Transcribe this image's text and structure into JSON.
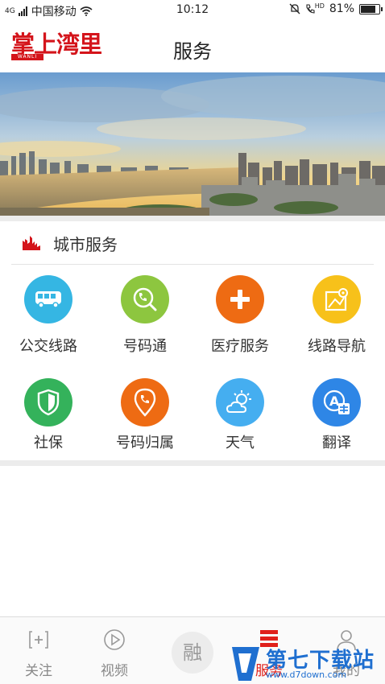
{
  "status_bar": {
    "signal_label": "4G",
    "carrier": "中国移动",
    "time": "10:12",
    "hd_label": "HD",
    "battery_text": "81%",
    "battery_level": 0.81
  },
  "header": {
    "logo_text": "掌上湾里",
    "logo_sub": "WANLI",
    "title": "服务"
  },
  "section": {
    "title": "城市服务"
  },
  "services": [
    {
      "label": "公交线路",
      "icon": "bus-icon",
      "color": "#35b6e3"
    },
    {
      "label": "号码通",
      "icon": "phone-search-icon",
      "color": "#8dc63f"
    },
    {
      "label": "医疗服务",
      "icon": "medical-plus-icon",
      "color": "#ee6b13"
    },
    {
      "label": "线路导航",
      "icon": "map-navigation-icon",
      "color": "#f7c11a"
    },
    {
      "label": "社保",
      "icon": "shield-icon",
      "color": "#34b25b"
    },
    {
      "label": "号码归属",
      "icon": "phone-location-icon",
      "color": "#ee6b13"
    },
    {
      "label": "天气",
      "icon": "weather-icon",
      "color": "#45aef0"
    },
    {
      "label": "翻译",
      "icon": "translate-icon",
      "color": "#2e86e6"
    }
  ],
  "tabbar": {
    "tabs": [
      {
        "label": "关注",
        "icon": "follow-icon"
      },
      {
        "label": "视频",
        "icon": "play-icon"
      },
      {
        "label": "融",
        "icon": "rong-icon"
      },
      {
        "label": "服务",
        "icon": "service-icon",
        "active": true
      },
      {
        "label": "我的",
        "icon": "user-icon"
      }
    ]
  },
  "watermark": {
    "text": "第七下载站",
    "url": "www.d7down.com"
  },
  "colors": {
    "brand_red": "#d4141b",
    "active_tab": "#e0201b",
    "watermark_blue": "#1f6fd0"
  }
}
